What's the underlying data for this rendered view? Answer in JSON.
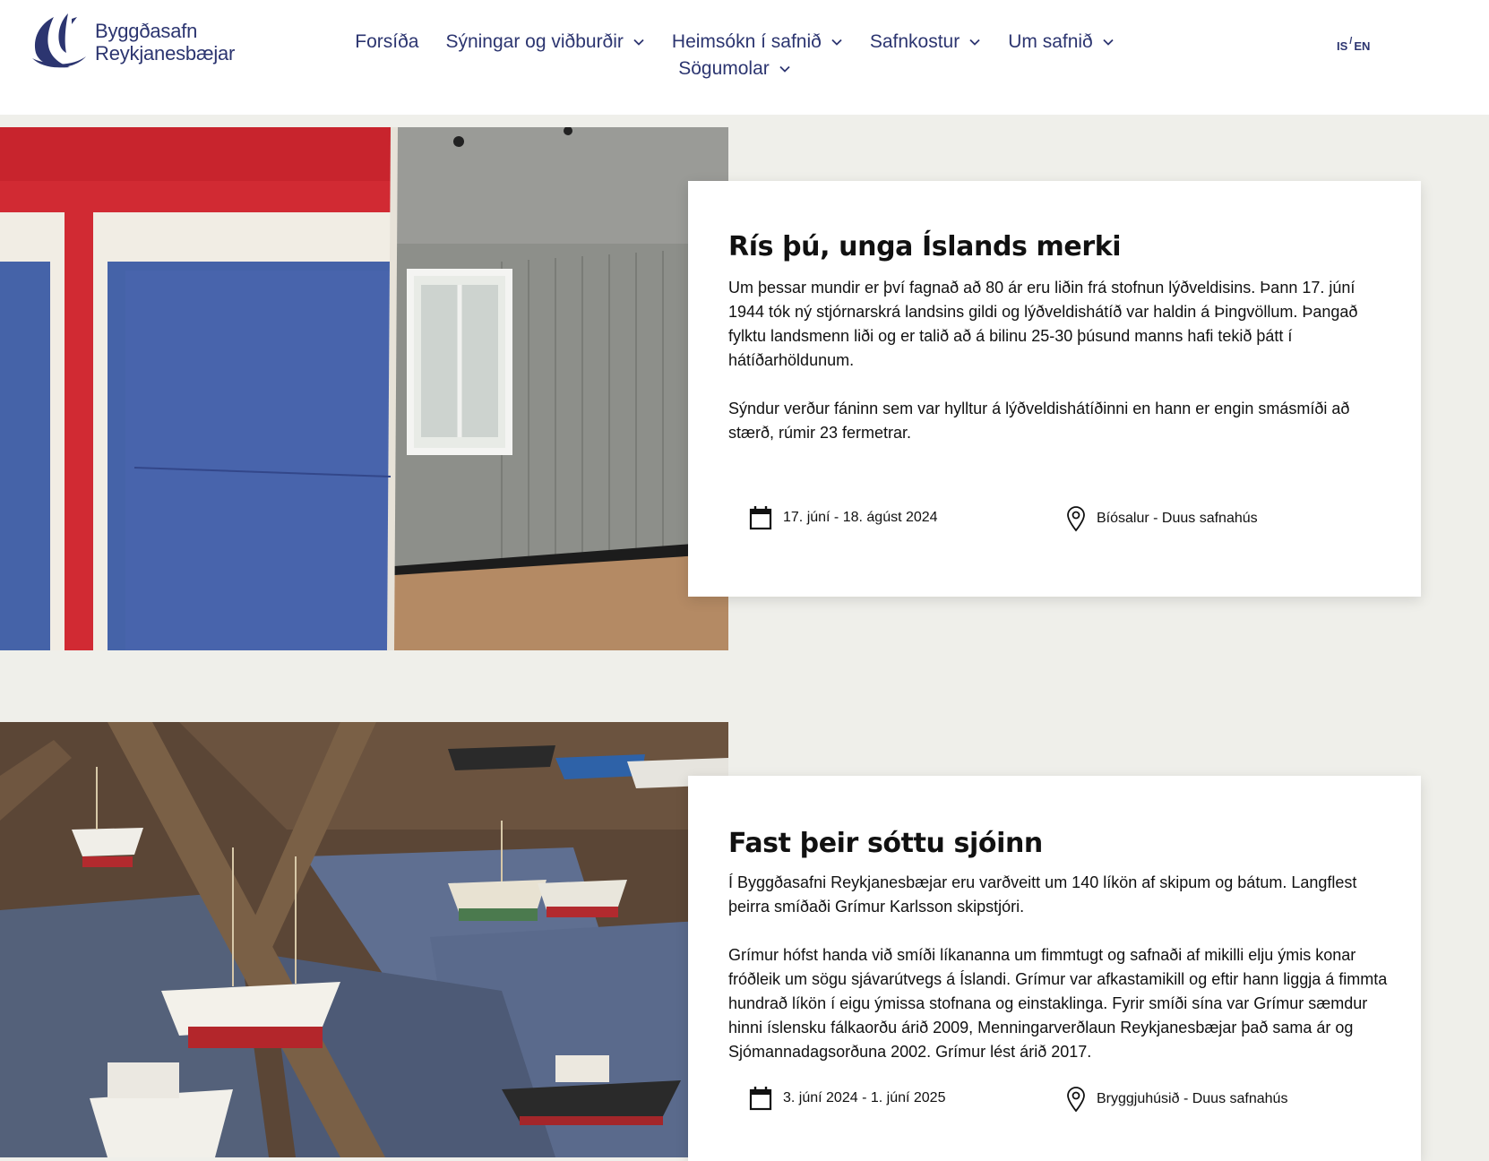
{
  "header": {
    "logo": {
      "line1": "Byggðasafn",
      "line2": "Reykjanesbæjar",
      "icon": "ship-sail-logo"
    },
    "nav": [
      {
        "label": "Forsíða",
        "has_dropdown": false
      },
      {
        "label": "Sýningar og viðburðir",
        "has_dropdown": true
      },
      {
        "label": "Heimsókn í safnið",
        "has_dropdown": true
      },
      {
        "label": "Safnkostur",
        "has_dropdown": true
      },
      {
        "label": "Um safnið",
        "has_dropdown": true
      },
      {
        "label": "Sögumolar",
        "has_dropdown": true
      }
    ],
    "lang": {
      "is": "IS",
      "sep": "/",
      "en": "EN"
    }
  },
  "colors": {
    "brand": "#2c3570",
    "page_bg": "#efefea",
    "card_bg": "#ffffff"
  },
  "exhibitions": [
    {
      "title": "Rís þú, unga Íslands merki",
      "paragraphs": [
        "Um þessar mundir er því fagnað að 80 ár eru liðin frá stofnun lýðveldisins. Þann 17. júní 1944 tók ný stjórnarskrá landsins gildi og lýðveldishátíð var haldin á Þingvöllum. Þangað fylktu landsmenn liði og er talið að á bilinu 25-30 þúsund manns hafi tekið þátt í hátíðarhöldunum.",
        "Sýndur verður fáninn sem var hylltur á lýðveldishátíðinni en hann er engin smásmíði að stærð, rúmir 23 fermetrar."
      ],
      "date": "17. júní - 18. ágúst  2024",
      "location": "Bíósalur - Duus safnahús",
      "image": "icelandic-flag-in-gallery"
    },
    {
      "title": "Fast þeir sóttu sjóinn",
      "paragraphs": [
        "Í Byggðasafni Reykjanesbæjar eru varðveitt um 140 líkön af skipum og bátum. Langflest þeirra smíðaði Grímur Karlsson skipstjóri.",
        "Grímur hófst handa við smíði líkananna um fimmtugt og safnaði af mikilli elju ýmis konar fróðleik um sögu sjávarútvegs á Íslandi. Grímur var afkastamikill og eftir hann liggja á fimmta hundrað líkön í eigu ýmissa stofnana og einstaklinga. Fyrir smíði sína var Grímur sæmdur hinni íslensku fálkaorðu árið 2009, Menningarverðlaun Reykjanesbæjar það sama ár og Sjómannadagsorðuna 2002. Grímur lést árið 2017."
      ],
      "date": "3. júní 2024 - 1. júní 2025",
      "location": "Bryggjuhúsið - Duus safnahús",
      "image": "ship-models-exhibition"
    }
  ]
}
